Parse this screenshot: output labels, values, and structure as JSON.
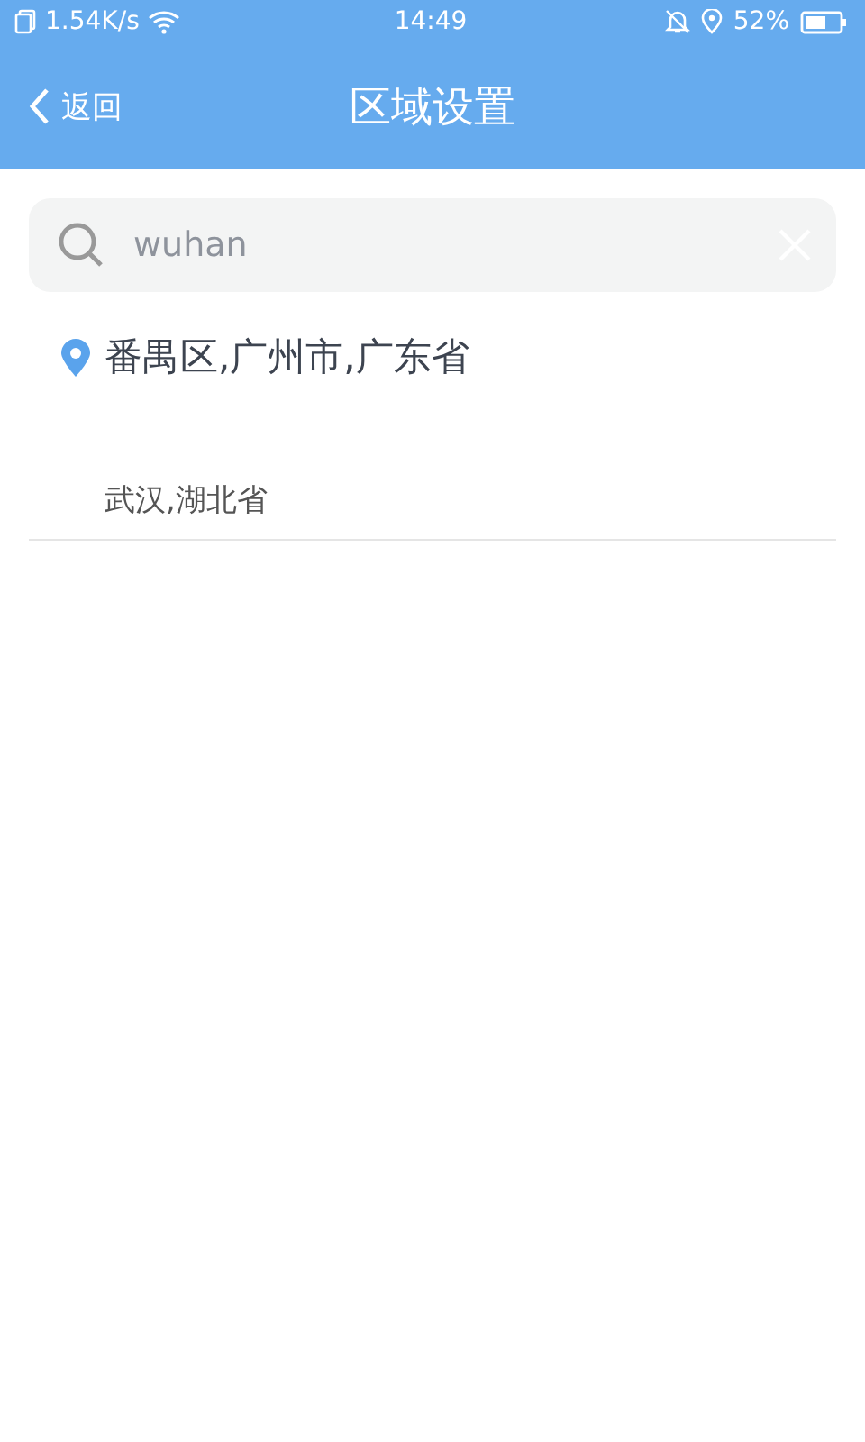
{
  "status_bar": {
    "speed": "1.54K/s",
    "time": "14:49",
    "battery": "52%"
  },
  "header": {
    "back": "返回",
    "title": "区域设置"
  },
  "search": {
    "value": "wuhan"
  },
  "current_location": "番禺区,广州市,广东省",
  "results": [
    "武汉,湖北省"
  ]
}
